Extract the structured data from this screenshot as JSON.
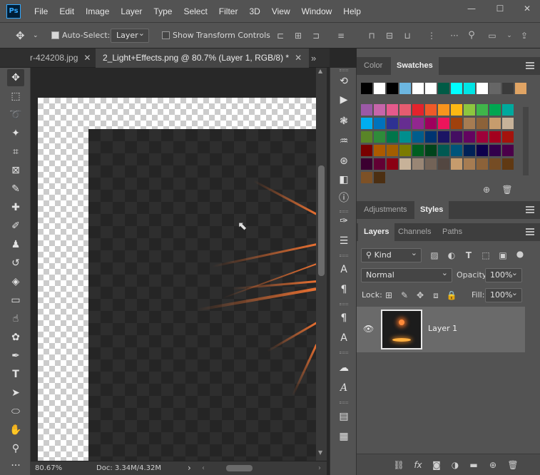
{
  "app": {
    "logo": "Ps",
    "window_controls": {
      "minimize": "—",
      "maximize": "☐",
      "close": "✕"
    }
  },
  "menu": [
    "File",
    "Edit",
    "Image",
    "Layer",
    "Type",
    "Select",
    "Filter",
    "3D",
    "View",
    "Window",
    "Help"
  ],
  "options_bar": {
    "auto_select_label": "Auto-Select:",
    "auto_select_checked": true,
    "target": "Layer",
    "transform_label": "Show Transform Controls",
    "transform_checked": false
  },
  "document_tabs": [
    {
      "label": "r-424208.jpg",
      "close": "✕",
      "active": false
    },
    {
      "label": "2_Light+Effects.png @ 80.7% (Layer 1, RGB/8) *",
      "close": "✕",
      "active": true
    }
  ],
  "tabs_overflow": "»",
  "status_bar": {
    "zoom": "80.67%",
    "doc": "Doc: 3.34M/4.32M",
    "arrow": "›"
  },
  "swatches_panel": {
    "tabs": [
      "Color",
      "Swatches"
    ],
    "active_tab": "Swatches",
    "top_row": [
      "#000000",
      "#ffffff",
      "#000000",
      "#6cb6e0",
      "#ffffff",
      "#ffffff",
      "#005b46",
      "#00ffff",
      "#00e5e5",
      "#ffffff",
      "#666666",
      "#3b3b3b",
      "#e0a464"
    ],
    "rows": [
      [
        "#9b59a6",
        "#c665aa",
        "#e45a8c",
        "#e55c70",
        "#e3232c",
        "#ef5a28",
        "#f7941d",
        "#fcb813",
        "#8dc63f",
        "#3fb54a",
        "#00a651",
        "#00a99d"
      ],
      [
        "#00aeef",
        "#0072bc",
        "#2e3192",
        "#662d91",
        "#92278f",
        "#9e005d",
        "#ed145b",
        "#a0410d",
        "#a67c52",
        "#8c6239",
        "#c69c6d",
        "#c7b299"
      ],
      [
        "#598527",
        "#2f8b3a",
        "#00754a",
        "#008e8e",
        "#005d8c",
        "#003471",
        "#1b1464",
        "#440e62",
        "#630460",
        "#9e0039",
        "#a3001e",
        "#a4130c"
      ],
      [
        "#790000",
        "#ad5a00",
        "#a35e00",
        "#7b7b00",
        "#005e20",
        "#00441b",
        "#005952",
        "#00547a",
        "#002157",
        "#0d004c",
        "#32004b",
        "#4b0049"
      ],
      [
        "#3b0030",
        "#620034",
        "#8b0013",
        "#c7b299",
        "#998675",
        "#736357",
        "#534741",
        "#c69c6d",
        "#a67c52",
        "#8c6239",
        "#754c24",
        "#603913"
      ],
      [
        "#7d5126",
        "#4c2f12"
      ]
    ]
  },
  "adjust_panel": {
    "tabs": [
      "Adjustments",
      "Styles"
    ],
    "active_tab": "Styles"
  },
  "layers_panel": {
    "tabs": [
      "Layers",
      "Channels",
      "Paths"
    ],
    "active_tab": "Layers",
    "filter_kind": "Kind",
    "blend_mode": "Normal",
    "opacity_label": "Opacity:",
    "opacity_value": "100%",
    "lock_label": "Lock:",
    "fill_label": "Fill:",
    "fill_value": "100%",
    "layers": [
      {
        "name": "Layer 1",
        "visible": true
      }
    ]
  },
  "icons": {
    "move_tool": "move-icon",
    "marquee": "rect-marquee-icon",
    "lasso": "lasso-icon",
    "magic_wand": "magic-wand-icon",
    "crop": "crop-icon",
    "frame": "frame-icon",
    "eyedropper": "eyedropper-icon",
    "healing": "healing-brush-icon",
    "brush": "brush-icon",
    "stamp": "clone-stamp-icon",
    "history_brush": "history-brush-icon",
    "eraser": "eraser-icon",
    "gradient": "gradient-icon",
    "smudge": "smudge-icon",
    "dodge": "dodge-icon",
    "pen": "pen-icon",
    "type": "type-icon",
    "path_select": "path-selection-icon",
    "ellipse": "ellipse-icon",
    "hand": "hand-icon",
    "zoom": "zoom-icon",
    "more": "more-icon"
  },
  "tool_type_glyph": "T",
  "styles_type_glyph": "A"
}
